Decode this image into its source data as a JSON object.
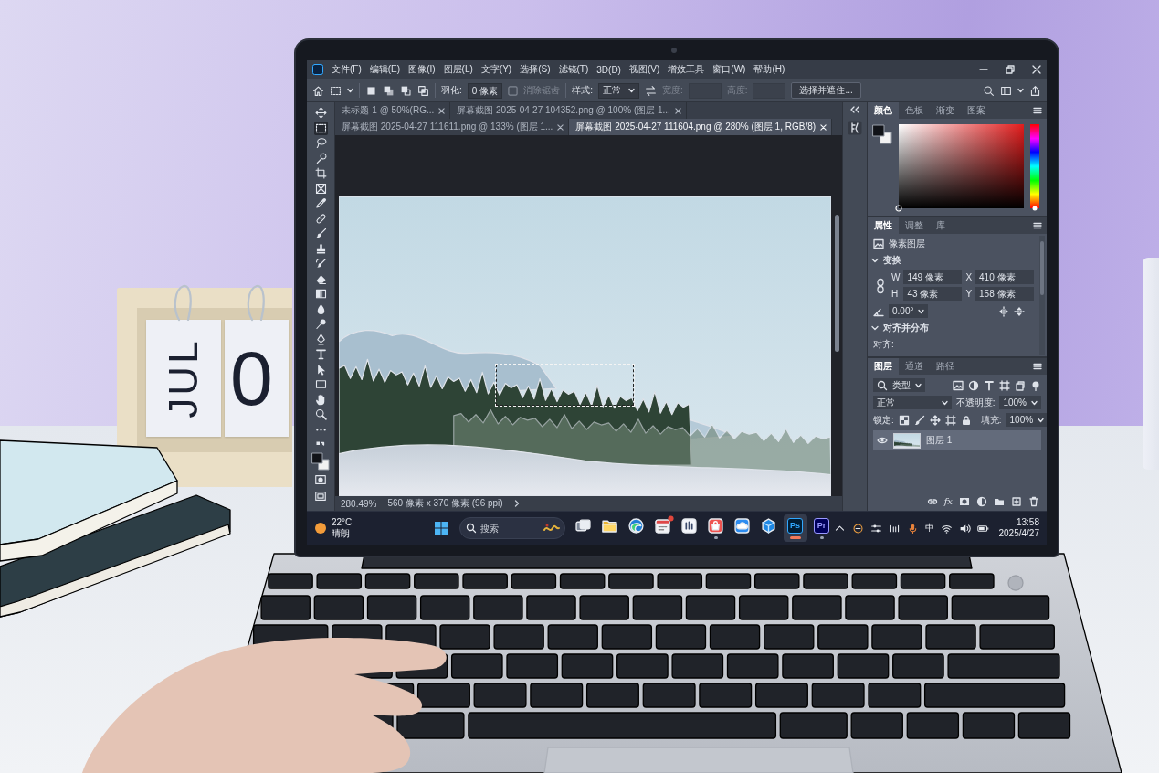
{
  "calendar": {
    "month": "JUL",
    "day": "0"
  },
  "photoshop": {
    "menu": [
      "文件(F)",
      "编辑(E)",
      "图像(I)",
      "图层(L)",
      "文字(Y)",
      "选择(S)",
      "滤镜(T)",
      "3D(D)",
      "视图(V)",
      "增效工具",
      "窗口(W)",
      "帮助(H)"
    ],
    "options": {
      "feather_label": "羽化:",
      "feather_value": "0 像素",
      "anti_alias": {
        "label": "消除锯齿",
        "disabled": true
      },
      "style_label": "样式:",
      "style_value": "正常",
      "width_label": "宽度:",
      "height_label": "高度:",
      "mask_button": "选择并遮住..."
    },
    "tabs": [
      {
        "label": "未标题-1 @ 50%(RG...",
        "selected": false
      },
      {
        "label": "屏幕截图 2025-04-27 104352.png @ 100% (图层 1...",
        "selected": false
      },
      {
        "label": "屏幕截图 2025-04-27 111611.png @ 133% (图层 1...",
        "selected": false
      },
      {
        "label": "屏幕截图 2025-04-27 111604.png @ 280% (图层 1, RGB/8)",
        "selected": true
      }
    ],
    "tools": [
      {
        "kind": "move",
        "selected": false
      },
      {
        "kind": "marquee",
        "selected": true
      },
      {
        "kind": "lasso",
        "selected": false
      },
      {
        "kind": "quick",
        "selected": false
      },
      {
        "kind": "crop",
        "selected": false
      },
      {
        "kind": "frame",
        "selected": false
      },
      {
        "kind": "eyedropper",
        "selected": false
      },
      {
        "kind": "healing",
        "selected": false
      },
      {
        "kind": "brush",
        "selected": false
      },
      {
        "kind": "stamp",
        "selected": false
      },
      {
        "kind": "history",
        "selected": false
      },
      {
        "kind": "eraser",
        "selected": false
      },
      {
        "kind": "gradient",
        "selected": false
      },
      {
        "kind": "blur",
        "selected": false
      },
      {
        "kind": "dodge",
        "selected": false
      },
      {
        "kind": "pen",
        "selected": false
      },
      {
        "kind": "type",
        "selected": false
      },
      {
        "kind": "path",
        "selected": false
      },
      {
        "kind": "rect",
        "selected": false
      },
      {
        "kind": "hand",
        "selected": false
      },
      {
        "kind": "zoom",
        "selected": false
      },
      {
        "kind": "more",
        "selected": false
      }
    ],
    "status": {
      "zoom": "280.49%",
      "document_size": "560 像素 x 370 像素 (96 ppi)"
    },
    "color_panel": {
      "tabs": [
        {
          "label": "颜色",
          "selected": true
        },
        {
          "label": "色板",
          "selected": false
        },
        {
          "label": "渐变",
          "selected": false
        },
        {
          "label": "图案",
          "selected": false
        }
      ],
      "hue_slider": {
        "level": 0
      }
    },
    "properties_panel": {
      "tabs": [
        {
          "label": "属性",
          "selected": true
        },
        {
          "label": "调整",
          "selected": false
        },
        {
          "label": "库",
          "selected": false
        }
      ],
      "layer_type": "像素图层",
      "transform": {
        "title": "变换",
        "expanded": true,
        "fields": [
          {
            "label": "W",
            "value": "149 像素"
          },
          {
            "label": "X",
            "value": "410 像素"
          },
          {
            "label": "H",
            "value": "43 像素"
          },
          {
            "label": "Y",
            "value": "158 像素"
          }
        ],
        "angle": "0.00°"
      },
      "align": {
        "title": "对齐并分布",
        "expanded": true,
        "label": "对齐:"
      }
    },
    "layers_panel": {
      "tabs": [
        {
          "label": "图层",
          "selected": true
        },
        {
          "label": "通道",
          "selected": false
        },
        {
          "label": "路径",
          "selected": false
        }
      ],
      "filter": "类型",
      "blend_mode": "正常",
      "opacity_label": "不透明度:",
      "opacity": "100%",
      "lock_label": "锁定:",
      "fill_label": "填充:",
      "fill": "100%",
      "layers": [
        {
          "name": "图层 1",
          "visible": true,
          "selected": true
        }
      ],
      "effects_button": "fx"
    }
  },
  "taskbar": {
    "weather": {
      "temperature": "22°C",
      "condition": "晴朗"
    },
    "search": {
      "placeholder": "搜索"
    },
    "apps": [
      {
        "kind": "task-view",
        "open": false,
        "selected": false,
        "badge": false
      },
      {
        "kind": "explorer",
        "open": false,
        "selected": false,
        "badge": false
      },
      {
        "kind": "browser",
        "open": false,
        "selected": false,
        "badge": false
      },
      {
        "kind": "calendar",
        "open": false,
        "selected": false,
        "badge": true
      },
      {
        "kind": "chart",
        "open": false,
        "selected": false,
        "badge": false
      },
      {
        "kind": "bag",
        "open": true,
        "selected": false,
        "badge": false
      },
      {
        "kind": "cloud",
        "open": false,
        "selected": false,
        "badge": false
      },
      {
        "kind": "cube",
        "open": false,
        "selected": false,
        "badge": false
      },
      {
        "kind": "photoshop",
        "label": "Ps",
        "open": true,
        "selected": true,
        "badge": false
      },
      {
        "kind": "premiere",
        "label": "Pr",
        "open": true,
        "selected": false,
        "badge": false
      }
    ],
    "tray": {
      "input_method": "中",
      "time": "13:58",
      "date": "2025/4/27"
    }
  }
}
